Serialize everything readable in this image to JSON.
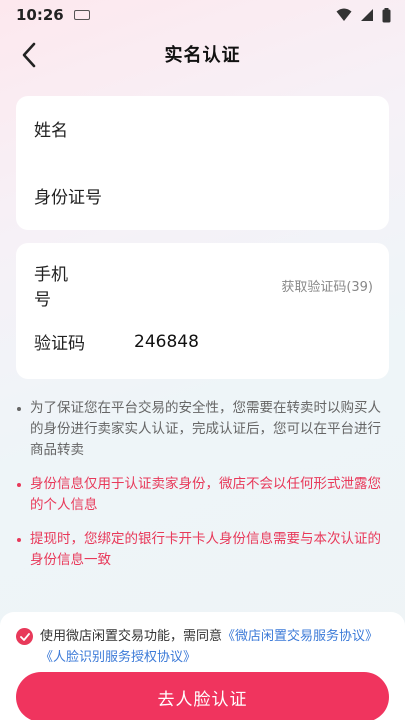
{
  "status_bar": {
    "time": "10:26"
  },
  "nav": {
    "title": "实名认证"
  },
  "identity": {
    "name_label": "姓名",
    "name_value": "",
    "id_label": "身份证号",
    "id_value": ""
  },
  "verify": {
    "phone_label": "手机号",
    "phone_value": "",
    "get_code": "获取验证码(39)",
    "code_label": "验证码",
    "code_value": "246848"
  },
  "notes": [
    "为了保证您在平台交易的安全性，您需要在转卖时以购买人的身份进行卖家实人认证，完成认证后，您可以在平台进行商品转卖",
    "身份信息仅用于认证卖家身份，微店不会以任何形式泄露您的个人信息",
    "提现时，您绑定的银行卡开卡人身份信息需要与本次认证的身份信息一致"
  ],
  "agreement": {
    "prefix": "使用微店闲置交易功能，需同意",
    "link1": "《微店闲置交易服务协议》",
    "link2": "《人脸识别服务授权协议》",
    "checked": true
  },
  "cta": {
    "label": "去人脸认证"
  },
  "colors": {
    "accent": "#f0345e",
    "link": "#3d7bd8",
    "warning_text": "#e8395a"
  }
}
